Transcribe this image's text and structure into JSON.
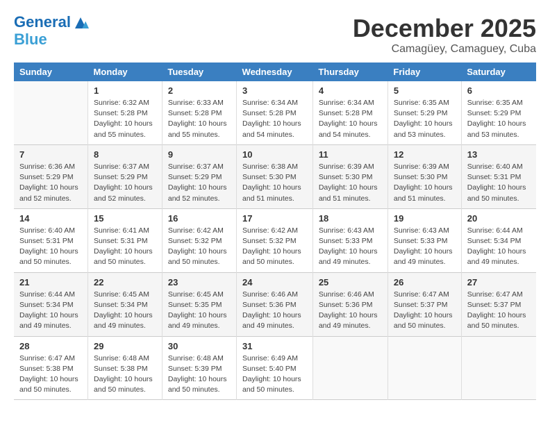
{
  "header": {
    "logo_line1": "General",
    "logo_line2": "Blue",
    "month": "December 2025",
    "location": "Camagüey, Camaguey, Cuba"
  },
  "weekdays": [
    "Sunday",
    "Monday",
    "Tuesday",
    "Wednesday",
    "Thursday",
    "Friday",
    "Saturday"
  ],
  "weeks": [
    [
      {
        "day": "",
        "info": ""
      },
      {
        "day": "1",
        "info": "Sunrise: 6:32 AM\nSunset: 5:28 PM\nDaylight: 10 hours\nand 55 minutes."
      },
      {
        "day": "2",
        "info": "Sunrise: 6:33 AM\nSunset: 5:28 PM\nDaylight: 10 hours\nand 55 minutes."
      },
      {
        "day": "3",
        "info": "Sunrise: 6:34 AM\nSunset: 5:28 PM\nDaylight: 10 hours\nand 54 minutes."
      },
      {
        "day": "4",
        "info": "Sunrise: 6:34 AM\nSunset: 5:28 PM\nDaylight: 10 hours\nand 54 minutes."
      },
      {
        "day": "5",
        "info": "Sunrise: 6:35 AM\nSunset: 5:29 PM\nDaylight: 10 hours\nand 53 minutes."
      },
      {
        "day": "6",
        "info": "Sunrise: 6:35 AM\nSunset: 5:29 PM\nDaylight: 10 hours\nand 53 minutes."
      }
    ],
    [
      {
        "day": "7",
        "info": "Sunrise: 6:36 AM\nSunset: 5:29 PM\nDaylight: 10 hours\nand 52 minutes."
      },
      {
        "day": "8",
        "info": "Sunrise: 6:37 AM\nSunset: 5:29 PM\nDaylight: 10 hours\nand 52 minutes."
      },
      {
        "day": "9",
        "info": "Sunrise: 6:37 AM\nSunset: 5:29 PM\nDaylight: 10 hours\nand 52 minutes."
      },
      {
        "day": "10",
        "info": "Sunrise: 6:38 AM\nSunset: 5:30 PM\nDaylight: 10 hours\nand 51 minutes."
      },
      {
        "day": "11",
        "info": "Sunrise: 6:39 AM\nSunset: 5:30 PM\nDaylight: 10 hours\nand 51 minutes."
      },
      {
        "day": "12",
        "info": "Sunrise: 6:39 AM\nSunset: 5:30 PM\nDaylight: 10 hours\nand 51 minutes."
      },
      {
        "day": "13",
        "info": "Sunrise: 6:40 AM\nSunset: 5:31 PM\nDaylight: 10 hours\nand 50 minutes."
      }
    ],
    [
      {
        "day": "14",
        "info": "Sunrise: 6:40 AM\nSunset: 5:31 PM\nDaylight: 10 hours\nand 50 minutes."
      },
      {
        "day": "15",
        "info": "Sunrise: 6:41 AM\nSunset: 5:31 PM\nDaylight: 10 hours\nand 50 minutes."
      },
      {
        "day": "16",
        "info": "Sunrise: 6:42 AM\nSunset: 5:32 PM\nDaylight: 10 hours\nand 50 minutes."
      },
      {
        "day": "17",
        "info": "Sunrise: 6:42 AM\nSunset: 5:32 PM\nDaylight: 10 hours\nand 50 minutes."
      },
      {
        "day": "18",
        "info": "Sunrise: 6:43 AM\nSunset: 5:33 PM\nDaylight: 10 hours\nand 49 minutes."
      },
      {
        "day": "19",
        "info": "Sunrise: 6:43 AM\nSunset: 5:33 PM\nDaylight: 10 hours\nand 49 minutes."
      },
      {
        "day": "20",
        "info": "Sunrise: 6:44 AM\nSunset: 5:34 PM\nDaylight: 10 hours\nand 49 minutes."
      }
    ],
    [
      {
        "day": "21",
        "info": "Sunrise: 6:44 AM\nSunset: 5:34 PM\nDaylight: 10 hours\nand 49 minutes."
      },
      {
        "day": "22",
        "info": "Sunrise: 6:45 AM\nSunset: 5:34 PM\nDaylight: 10 hours\nand 49 minutes."
      },
      {
        "day": "23",
        "info": "Sunrise: 6:45 AM\nSunset: 5:35 PM\nDaylight: 10 hours\nand 49 minutes."
      },
      {
        "day": "24",
        "info": "Sunrise: 6:46 AM\nSunset: 5:36 PM\nDaylight: 10 hours\nand 49 minutes."
      },
      {
        "day": "25",
        "info": "Sunrise: 6:46 AM\nSunset: 5:36 PM\nDaylight: 10 hours\nand 49 minutes."
      },
      {
        "day": "26",
        "info": "Sunrise: 6:47 AM\nSunset: 5:37 PM\nDaylight: 10 hours\nand 50 minutes."
      },
      {
        "day": "27",
        "info": "Sunrise: 6:47 AM\nSunset: 5:37 PM\nDaylight: 10 hours\nand 50 minutes."
      }
    ],
    [
      {
        "day": "28",
        "info": "Sunrise: 6:47 AM\nSunset: 5:38 PM\nDaylight: 10 hours\nand 50 minutes."
      },
      {
        "day": "29",
        "info": "Sunrise: 6:48 AM\nSunset: 5:38 PM\nDaylight: 10 hours\nand 50 minutes."
      },
      {
        "day": "30",
        "info": "Sunrise: 6:48 AM\nSunset: 5:39 PM\nDaylight: 10 hours\nand 50 minutes."
      },
      {
        "day": "31",
        "info": "Sunrise: 6:49 AM\nSunset: 5:40 PM\nDaylight: 10 hours\nand 50 minutes."
      },
      {
        "day": "",
        "info": ""
      },
      {
        "day": "",
        "info": ""
      },
      {
        "day": "",
        "info": ""
      }
    ]
  ]
}
